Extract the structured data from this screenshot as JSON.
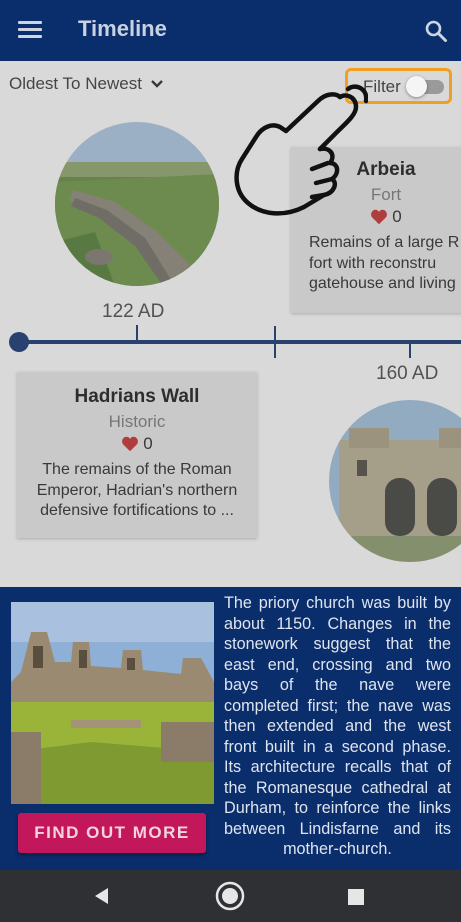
{
  "appbar": {
    "title": "Timeline",
    "menu_icon": "hamburger-menu-icon",
    "search_icon": "search-icon",
    "color": "#0a2d6b"
  },
  "controls": {
    "sort_label": "Oldest To Newest",
    "filter_label": "Filter",
    "filter_on": false,
    "highlight_color": "#f0a020"
  },
  "timeline": {
    "items": [
      {
        "year": "122 AD",
        "title": "Hadrians Wall",
        "category": "Historic",
        "likes": "0",
        "description": "The remains of the Roman Emperor, Hadrian's northern defensive fortifications to ..."
      },
      {
        "year": "160 AD",
        "title": "Arbeia",
        "category": "Fort",
        "likes": "0",
        "description": "Remains of a large R fort with reconstru gatehouse and living"
      }
    ]
  },
  "feature": {
    "button_label": "FIND OUT MORE",
    "button_color": "#c2185b",
    "text": "The priory church was built by about 1150. Changes in the stonework suggest that the east end, crossing and two bays of the nave were completed first; the nave was then extended and the west front built in a second phase. Its architecture recalls that of the Romanesque cathedral at Durham, to reinforce the links between Lindisfarne and its mother-church."
  },
  "navbar": {
    "back_icon": "back-triangle-icon",
    "home_icon": "home-circle-icon",
    "recents_icon": "recents-square-icon"
  }
}
